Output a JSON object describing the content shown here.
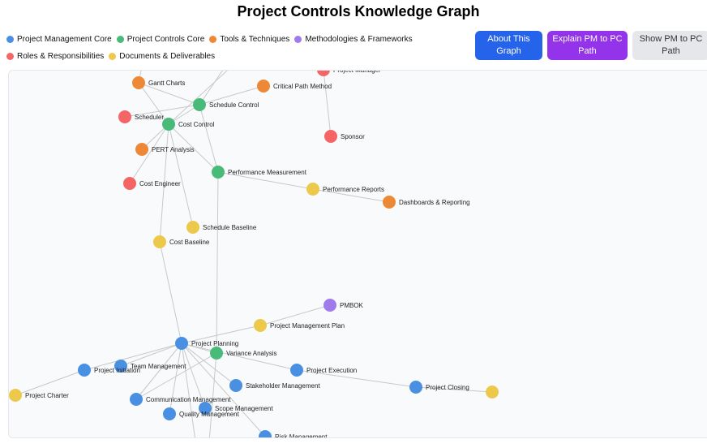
{
  "title": "Project Controls Knowledge Graph",
  "legend": [
    {
      "label": "Project Management Core",
      "color": "#4a90e2"
    },
    {
      "label": "Project Controls Core",
      "color": "#48bb78"
    },
    {
      "label": "Tools & Techniques",
      "color": "#ed8936"
    },
    {
      "label": "Methodologies & Frameworks",
      "color": "#9f7aea"
    },
    {
      "label": "Roles & Responsibilities",
      "color": "#f56565"
    },
    {
      "label": "Documents & Deliverables",
      "color": "#ecc94b"
    }
  ],
  "buttons": {
    "about": "About This Graph",
    "explain": "Explain PM to PC Path",
    "show": "Show PM to PC Path"
  },
  "graph": {
    "nodes": [
      {
        "id": "gantt",
        "label": "Gantt Charts",
        "cat": 2
      },
      {
        "id": "cpm",
        "label": "Critical Path Method",
        "cat": 2
      },
      {
        "id": "pm",
        "label": "Project Manager",
        "cat": 4
      },
      {
        "id": "sched_ctrl",
        "label": "Schedule Control",
        "cat": 1
      },
      {
        "id": "scheduler",
        "label": "Scheduler",
        "cat": 4
      },
      {
        "id": "cost_ctrl",
        "label": "Cost Control",
        "cat": 1
      },
      {
        "id": "sponsor",
        "label": "Sponsor",
        "cat": 4
      },
      {
        "id": "pert",
        "label": "PERT Analysis",
        "cat": 2
      },
      {
        "id": "perf_meas",
        "label": "Performance Measurement",
        "cat": 1
      },
      {
        "id": "cost_eng",
        "label": "Cost Engineer",
        "cat": 4
      },
      {
        "id": "perf_rep",
        "label": "Performance Reports",
        "cat": 5
      },
      {
        "id": "dash",
        "label": "Dashboards & Reporting",
        "cat": 2
      },
      {
        "id": "sched_base",
        "label": "Schedule Baseline",
        "cat": 5
      },
      {
        "id": "cost_base",
        "label": "Cost Baseline",
        "cat": 5
      },
      {
        "id": "pmbok",
        "label": "PMBOK",
        "cat": 3
      },
      {
        "id": "pmp",
        "label": "Project Management Plan",
        "cat": 5
      },
      {
        "id": "proj_plan",
        "label": "Project Planning",
        "cat": 0
      },
      {
        "id": "var_an",
        "label": "Variance Analysis",
        "cat": 1
      },
      {
        "id": "team_mgmt",
        "label": "Team Management",
        "cat": 0
      },
      {
        "id": "proj_init",
        "label": "Project Initiation",
        "cat": 0
      },
      {
        "id": "proj_exec",
        "label": "Project Execution",
        "cat": 0
      },
      {
        "id": "stake",
        "label": "Stakeholder Management",
        "cat": 0
      },
      {
        "id": "proj_close",
        "label": "Project Closing",
        "cat": 0
      },
      {
        "id": "doc_edge",
        "label": "",
        "cat": 5
      },
      {
        "id": "charter",
        "label": "Project Charter",
        "cat": 5
      },
      {
        "id": "comm",
        "label": "Communication Management",
        "cat": 0
      },
      {
        "id": "scope",
        "label": "Scope Management",
        "cat": 0
      },
      {
        "id": "quality",
        "label": "Quality Management",
        "cat": 0
      },
      {
        "id": "risk",
        "label": "Risk Management",
        "cat": 0
      }
    ],
    "edges": [
      [
        "gantt",
        "sched_ctrl"
      ],
      [
        "cpm",
        "sched_ctrl"
      ],
      [
        "pm",
        "sponsor"
      ],
      [
        "sched_ctrl",
        "cost_ctrl"
      ],
      [
        "sched_ctrl",
        "perf_meas"
      ],
      [
        "cost_ctrl",
        "perf_meas"
      ],
      [
        "scheduler",
        "sched_ctrl"
      ],
      [
        "cost_eng",
        "cost_ctrl"
      ],
      [
        "pert",
        "cost_ctrl"
      ],
      [
        "perf_meas",
        "perf_rep"
      ],
      [
        "perf_rep",
        "dash"
      ],
      [
        "sched_base",
        "cost_ctrl"
      ],
      [
        "cost_base",
        "cost_ctrl"
      ],
      [
        "cost_base",
        "proj_plan"
      ],
      [
        "perf_meas",
        "var_an"
      ],
      [
        "pmbok",
        "pmp"
      ],
      [
        "pmp",
        "proj_plan"
      ],
      [
        "proj_plan",
        "team_mgmt"
      ],
      [
        "proj_plan",
        "proj_init"
      ],
      [
        "proj_plan",
        "proj_exec"
      ],
      [
        "proj_plan",
        "stake"
      ],
      [
        "proj_plan",
        "comm"
      ],
      [
        "proj_plan",
        "scope"
      ],
      [
        "proj_plan",
        "quality"
      ],
      [
        "proj_plan",
        "risk"
      ],
      [
        "proj_exec",
        "proj_close"
      ],
      [
        "proj_close",
        "doc_edge"
      ],
      [
        "proj_init",
        "charter"
      ],
      [
        "proj_plan",
        "var_an"
      ],
      [
        "var_an",
        "comm"
      ],
      [
        "gantt",
        "top_a"
      ],
      [
        "sched_ctrl",
        "top_b"
      ],
      [
        "cost_ctrl",
        "top_c"
      ],
      [
        "gantt",
        "cost_ctrl"
      ],
      [
        "var_an",
        "bottom_a"
      ],
      [
        "proj_plan",
        "bottom_b"
      ]
    ]
  }
}
